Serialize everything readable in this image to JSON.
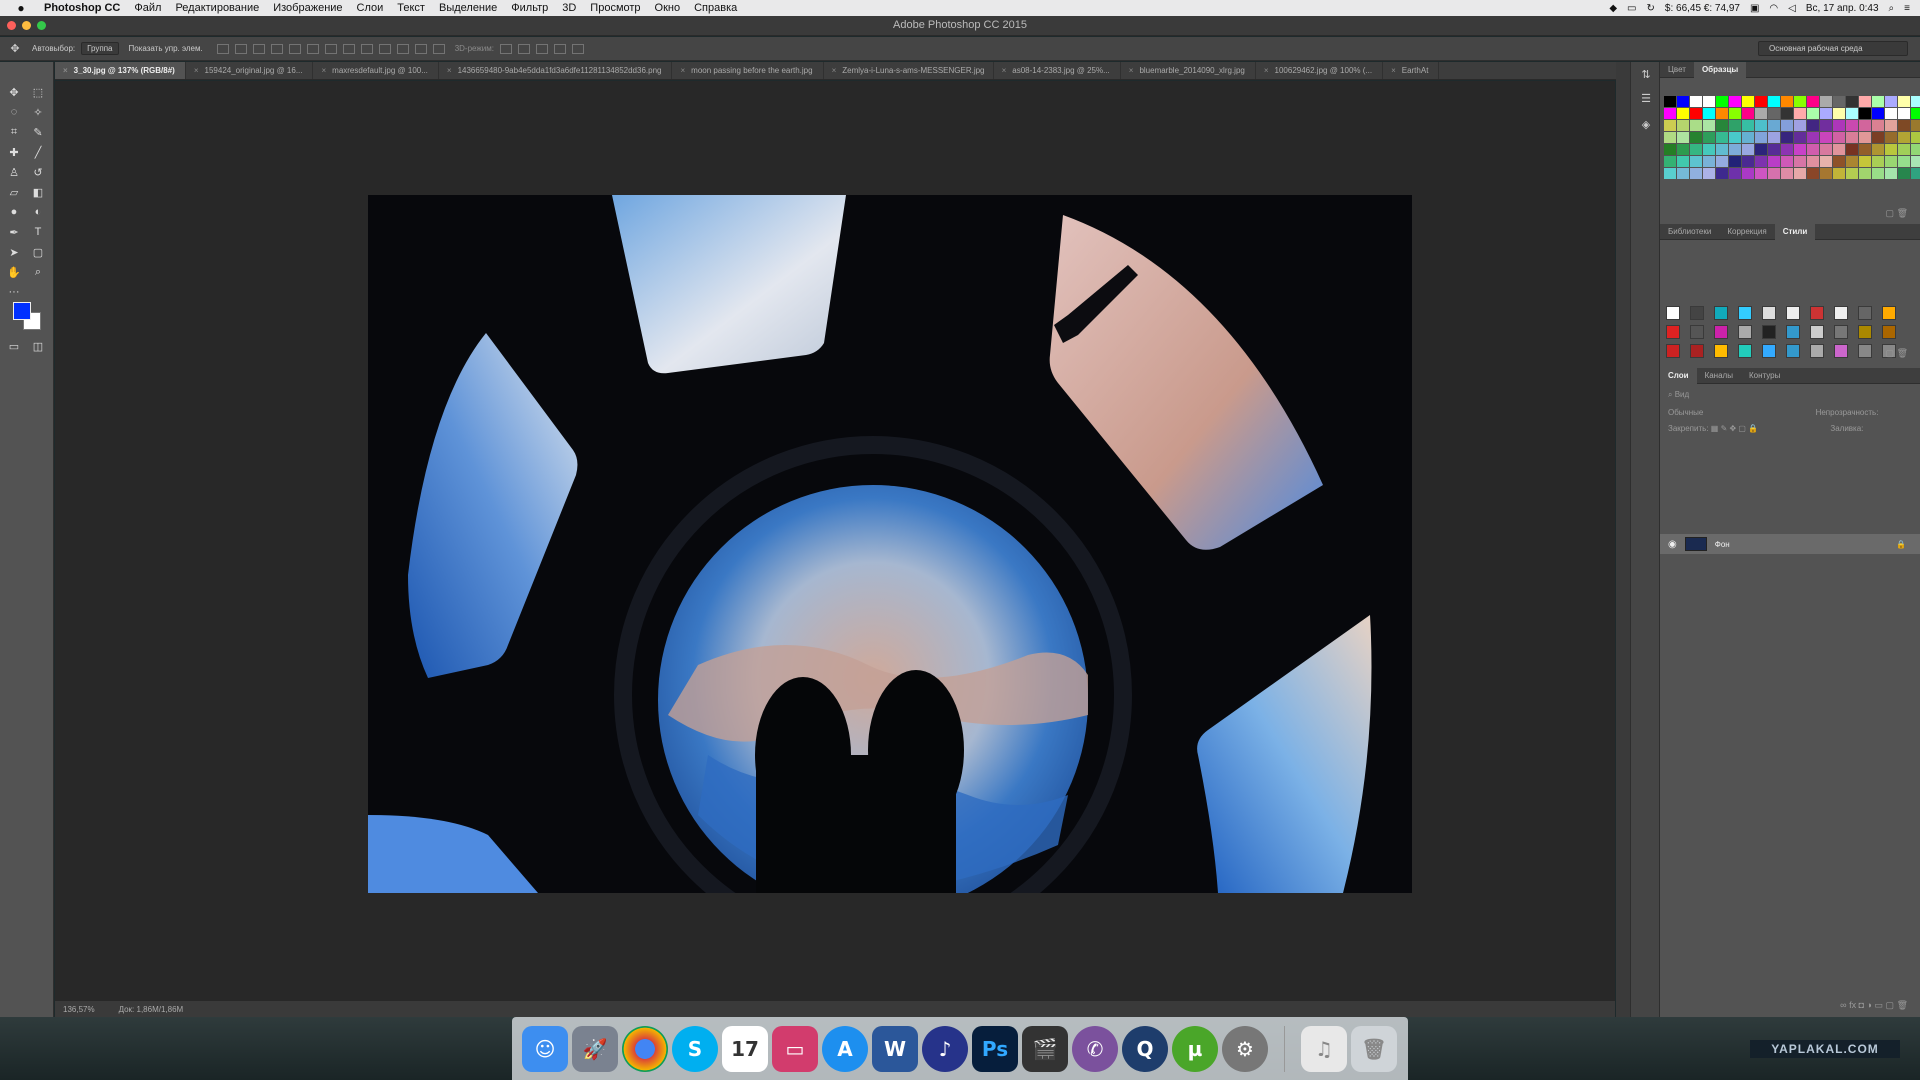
{
  "menubar": {
    "items": [
      "Photoshop CC",
      "Файл",
      "Редактирование",
      "Изображение",
      "Слои",
      "Текст",
      "Выделение",
      "Фильтр",
      "3D",
      "Просмотр",
      "Окно",
      "Справка"
    ],
    "currency": "$: 66,45 €: 74,97",
    "datetime": "Вс, 17 апр. 0:43"
  },
  "window": {
    "title": "Adobe Photoshop CC 2015"
  },
  "options": {
    "autoselect_label": "Автовыбор:",
    "autoselect_value": "Группа",
    "show_controls_label": "Показать упр. элем.",
    "threed_label": "3D-режим:",
    "workspace": "Основная рабочая среда"
  },
  "tabs": [
    {
      "label": "3_30.jpg @ 137% (RGB/8#)",
      "active": true
    },
    {
      "label": "159424_original.jpg @ 16..."
    },
    {
      "label": "maxresdefault.jpg @ 100..."
    },
    {
      "label": "1436659480-9ab4e5dda1fd3a6dfe11281134852dd36.png"
    },
    {
      "label": "moon passing before the earth.jpg"
    },
    {
      "label": "Zemlya-i-Luna-s-ams-MESSENGER.jpg"
    },
    {
      "label": "as08-14-2383.jpg @ 25%..."
    },
    {
      "label": "bluemarble_2014090_xlrg.jpg"
    },
    {
      "label": "100629462.jpg @ 100% (..."
    },
    {
      "label": "EarthAt"
    }
  ],
  "status": {
    "zoom": "136,57%",
    "doc": "Док: 1,86M/1,86M"
  },
  "panels": {
    "top_tabs": [
      "Цвет",
      "Образцы"
    ],
    "top_active": "Образцы",
    "mid_tabs": [
      "Библиотеки",
      "Коррекция",
      "Стили"
    ],
    "mid_active": "Стили",
    "layer_tabs": [
      "Слои",
      "Каналы",
      "Контуры"
    ],
    "layer_active": "Слои",
    "kind_placeholder": "Вид",
    "blend_mode": "Обычные",
    "opacity_label": "Непрозрачность:",
    "lock_label": "Закрепить:",
    "fill_label": "Заливка:",
    "layer_name": "Фон"
  },
  "dock": {
    "icons": [
      "finder-icon",
      "launchpad-icon",
      "chrome-icon",
      "skype-icon",
      "calendar-icon",
      "keynote-icon",
      "appstore-icon",
      "word-icon",
      "audiobook-icon",
      "photoshop-icon",
      "finalcut-icon",
      "viber-icon",
      "quicktime-icon",
      "utorrent-icon",
      "system-preferences-icon",
      "itunes-icon",
      "trash-icon"
    ],
    "calendar_day": "17"
  },
  "watermark": "YAPLAKAL.COM"
}
